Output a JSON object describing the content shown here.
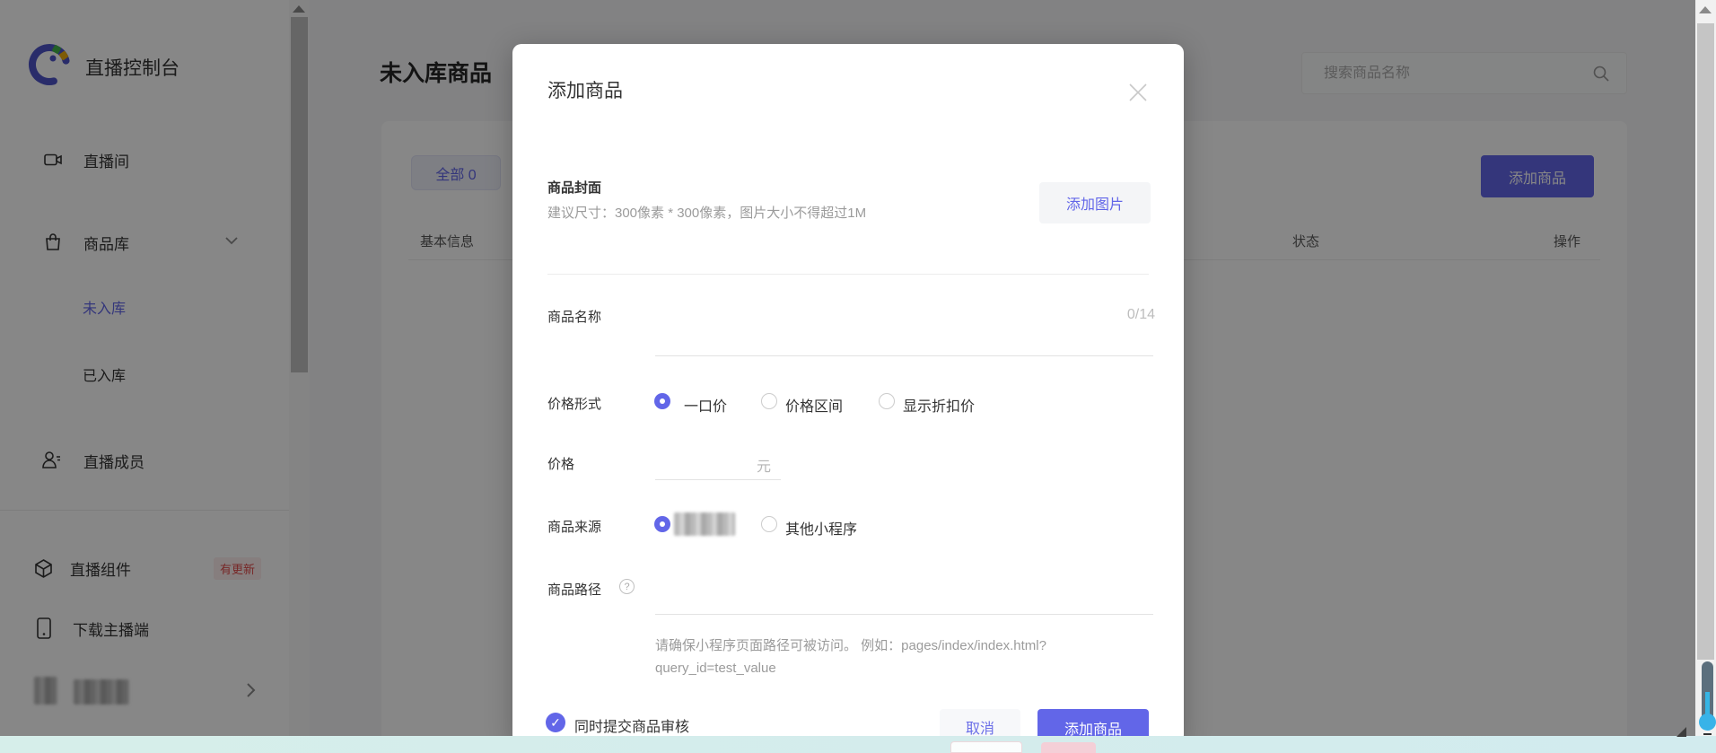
{
  "app": {
    "title": "直播控制台"
  },
  "sidebar": {
    "items": [
      {
        "label": "直播间"
      },
      {
        "label": "商品库"
      },
      {
        "label": "直播成员"
      },
      {
        "label": "直播组件",
        "badge": "有更新"
      },
      {
        "label": "下载主播端"
      }
    ],
    "sub_items": [
      {
        "label": "未入库",
        "active": true
      },
      {
        "label": "已入库",
        "active": false
      }
    ]
  },
  "main": {
    "page_title": "未入库商品",
    "search_placeholder": "搜索商品名称",
    "tab_all": "全部 0",
    "add_button": "添加商品",
    "table_headers": [
      "基本信息",
      "状态",
      "操作"
    ]
  },
  "modal": {
    "title": "添加商品",
    "cover": {
      "label": "商品封面",
      "hint": "建议尺寸：300像素 * 300像素，图片大小不得超过1M",
      "button": "添加图片"
    },
    "name": {
      "label": "商品名称",
      "counter": "0/14",
      "value": ""
    },
    "price_form": {
      "label": "价格形式",
      "options": [
        "一口价",
        "价格区间",
        "显示折扣价"
      ],
      "selected": "一口价"
    },
    "price": {
      "label": "价格",
      "unit": "元",
      "value": ""
    },
    "source": {
      "label": "商品来源",
      "other_option": "其他小程序"
    },
    "path": {
      "label": "商品路径",
      "hint": "请确保小程序页面路径可被访问。 例如：pages/index/index.html?query_id=test_value",
      "value": ""
    },
    "review_checkbox": {
      "label": "同时提交商品审核",
      "checked": true
    },
    "footer": {
      "cancel": "取消",
      "submit": "添加商品"
    }
  },
  "icons": {
    "question_mark": "?",
    "check": "✓"
  },
  "colors": {
    "accent": "#6266e8",
    "badge_red": "#e14b4b",
    "badge_bg": "#fdeeee",
    "strip_cyan": "#d6eeea",
    "scroll_widget_blue": "#38b3e8"
  }
}
